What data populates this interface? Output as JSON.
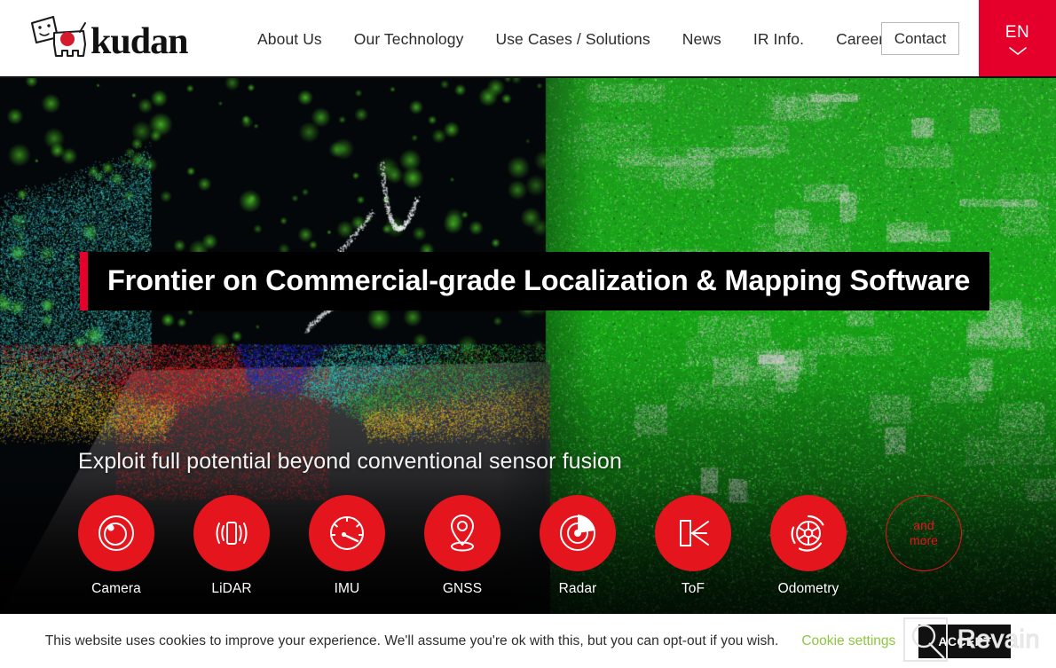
{
  "header": {
    "logo_name": "kudan-logo",
    "logo_text": "kudan",
    "nav": [
      {
        "label": "About Us",
        "name": "nav-about-us"
      },
      {
        "label": "Our Technology",
        "name": "nav-our-technology"
      },
      {
        "label": "Use Cases / Solutions",
        "name": "nav-use-cases-solutions"
      },
      {
        "label": "News",
        "name": "nav-news"
      },
      {
        "label": "IR Info.",
        "name": "nav-ir-info"
      },
      {
        "label": "Careers",
        "name": "nav-careers"
      }
    ],
    "contact_label": "Contact",
    "language": {
      "label": "EN",
      "icon": "chevron-down-icon"
    }
  },
  "hero": {
    "headline": "Frontier on Commercial-grade Localization & Mapping Software",
    "subhead": "Exploit full potential beyond conventional sensor fusion",
    "accent_color": "#e4002b",
    "icon_red": "#e4151c",
    "sensors": [
      {
        "label": "Camera",
        "icon": "camera-lens-icon"
      },
      {
        "label": "LiDAR",
        "icon": "lidar-waves-icon"
      },
      {
        "label": "IMU",
        "icon": "gauge-icon"
      },
      {
        "label": "GNSS",
        "icon": "map-pin-icon"
      },
      {
        "label": "Radar",
        "icon": "radar-sweep-icon"
      },
      {
        "label": "ToF",
        "icon": "time-of-flight-icon"
      },
      {
        "label": "Odometry",
        "icon": "wheel-icon"
      }
    ],
    "more": {
      "line1": "and",
      "line2": "more",
      "name": "and-more-badge"
    }
  },
  "cookie_banner": {
    "message": "This website uses cookies to improve your experience. We'll assume you're ok with this, but you can opt-out if you wish.",
    "settings_label": "Cookie settings",
    "settings_color": "#8cc63e",
    "accept_label": "ACCEPT"
  },
  "watermark": {
    "text": "Revain",
    "logo_name": "revain-logo-icon"
  }
}
